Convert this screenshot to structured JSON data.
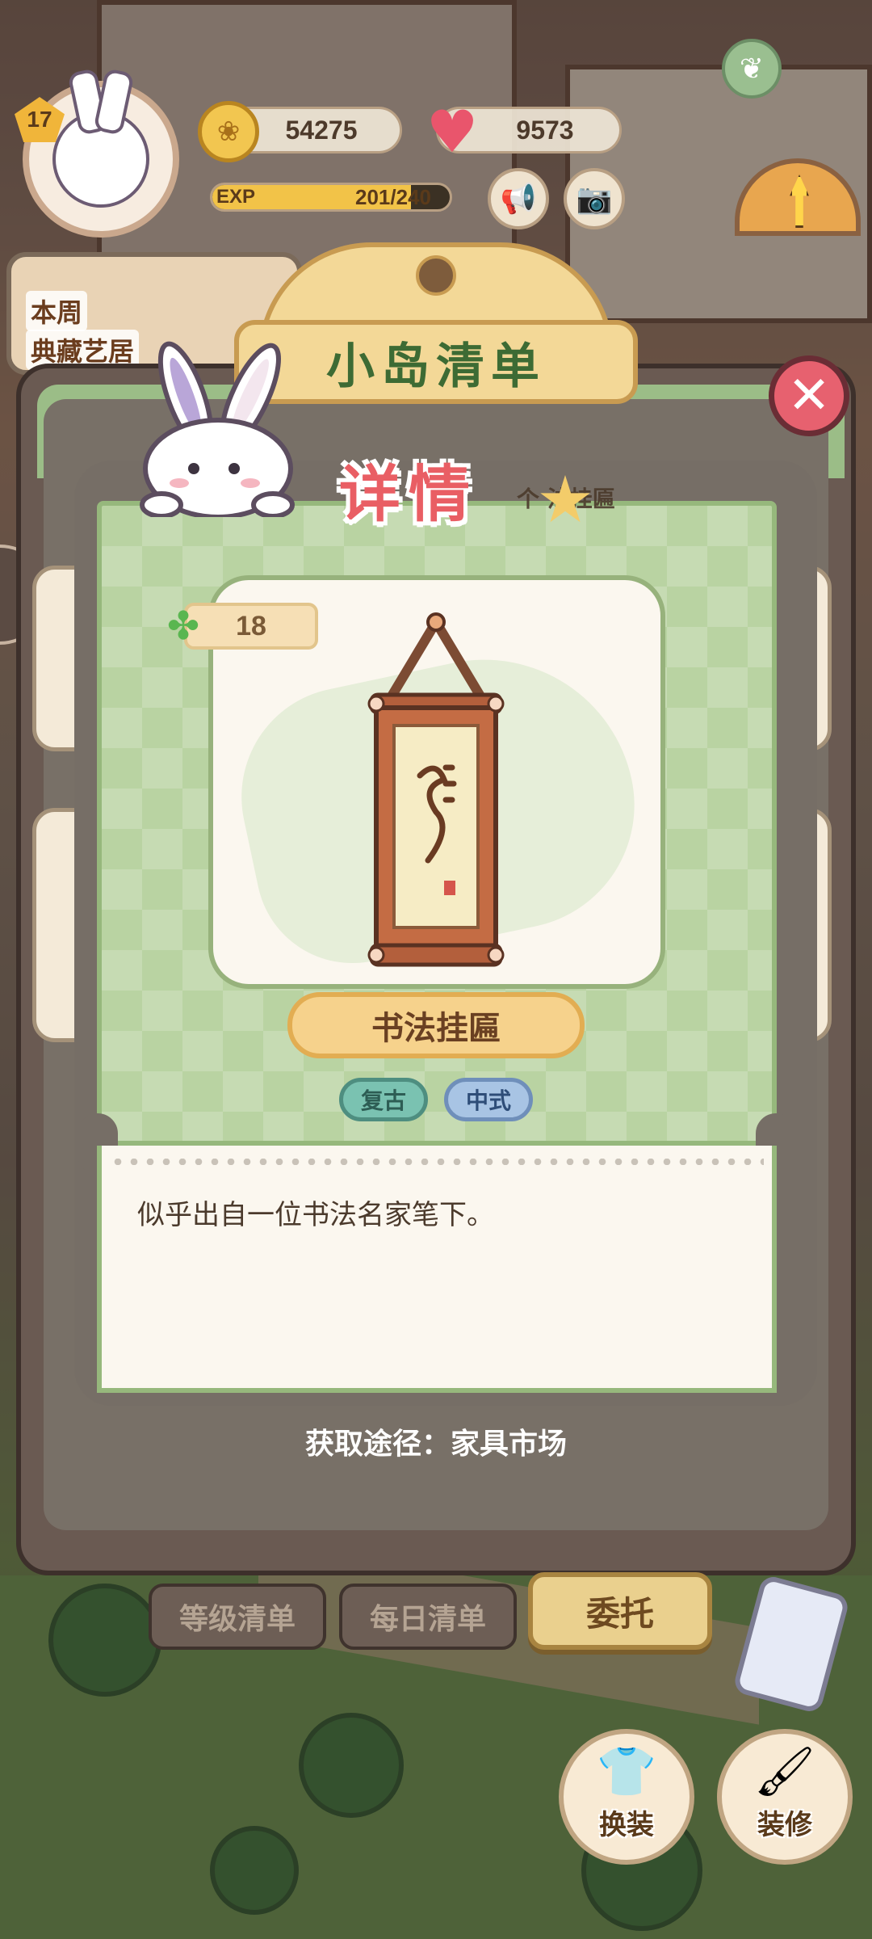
{
  "hud": {
    "level": "17",
    "coins": "54275",
    "hearts": "9573",
    "exp_label": "EXP",
    "exp_value": "201/240",
    "exp_fraction": 0.8375
  },
  "event_card": {
    "line1": "本周",
    "line2": "典藏艺居"
  },
  "panel": {
    "title": "小岛清单",
    "close_symbol": "✕"
  },
  "detail": {
    "title": "详情",
    "caption_partial": "个  法挂匾",
    "clover_count": "18",
    "item_name": "书法挂匾",
    "tags": [
      "复古",
      "中式"
    ],
    "description": "似乎出自一位书法名家笔下。",
    "source": "获取途径：家具市场"
  },
  "tabs": {
    "level_list": "等级清单",
    "daily_list": "每日清单",
    "entrust": "委托"
  },
  "actions": {
    "outfit": "换装",
    "decorate": "装修"
  },
  "icons": {
    "coin": "coin-icon",
    "heart": "heart-icon",
    "speaker": "speaker-icon",
    "camera": "camera-icon",
    "clover": "clover-icon",
    "close": "close-icon",
    "side_arrow": "chevron-right-icon",
    "compass": "compass-icon",
    "leaf": "leaf-icon"
  }
}
